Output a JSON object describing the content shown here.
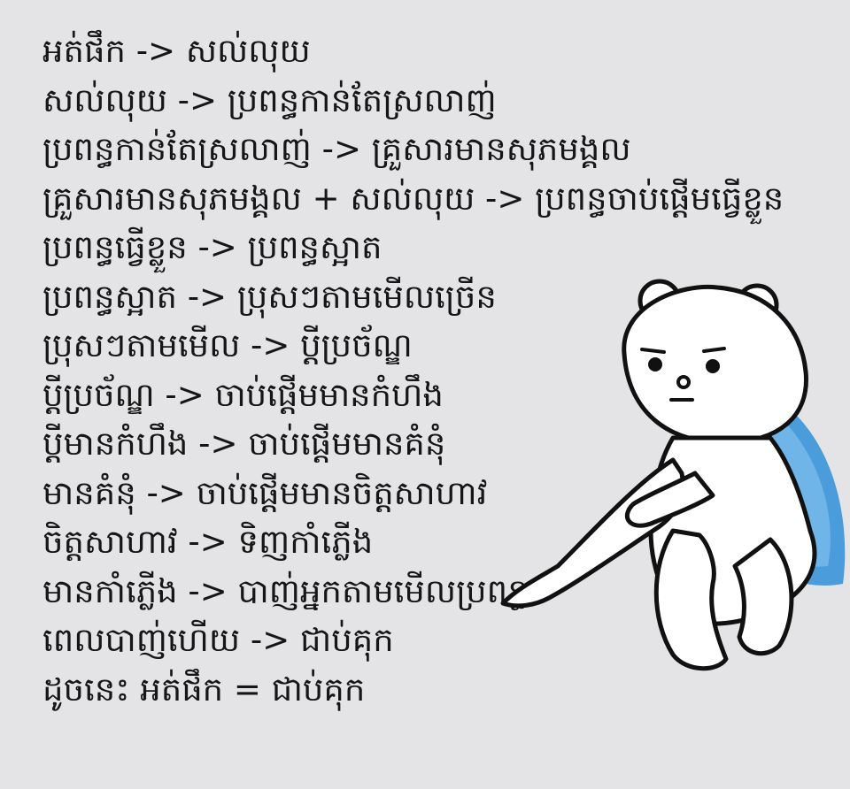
{
  "lines": [
    "អត់ផឹក -> សល់លុយ",
    "សល់លុយ -> ប្រពន្ធកាន់តែស្រលាញ់",
    "ប្រពន្ធកាន់តែស្រលាញ់ -> គ្រួសារមានសុភមង្គល",
    "គ្រួសារមានសុភមង្គល + សល់លុយ -> ប្រពន្ធចាប់ផ្តើមធ្វើខ្លួន",
    "ប្រពន្ធធ្វើខ្លួន -> ប្រពន្ធស្អាត",
    "ប្រពន្ធស្អាត -> ប្រុសៗតាមមើលច្រើន",
    "ប្រុសៗតាមមើល -> ប្តីប្រច័ណ្ឌ",
    "ប្តីប្រច័ណ្ឌ -> ចាប់ផ្តើមមានកំហឹង",
    "ប្តីមានកំហឹង -> ចាប់ផ្តើមមានគំនុំ",
    "មានគំនុំ -> ចាប់ផ្តើមមានចិត្តសាហាវ",
    "ចិត្តសាហាវ -> ទិញកាំភ្លើង",
    "មានកាំភ្លើង -> បាញ់អ្នកតាមមើលប្រពន្ធ",
    "ពេលបាញ់ហើយ -> ជាប់គុក",
    "ដូចនេះ អត់ផឹក = ជាប់គុក"
  ],
  "colors": {
    "background": "#e4e4e6",
    "text": "#161616",
    "bear_fill": "#ffffff",
    "bear_outline": "#111111",
    "shadow_blue": "#2f8fd8"
  }
}
